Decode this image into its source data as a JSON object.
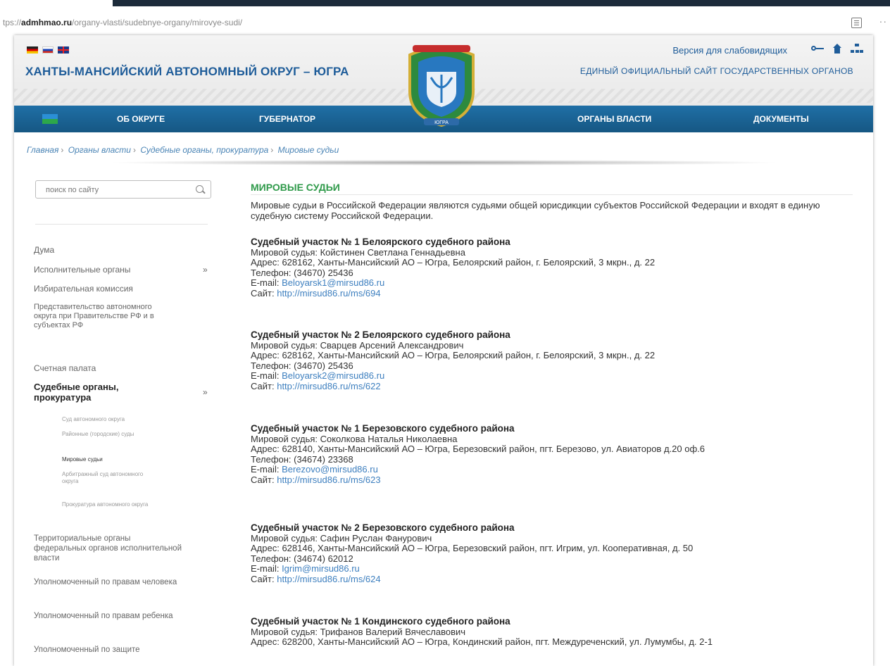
{
  "browser": {
    "url_prefix": "tps://",
    "url_host": "admhmao.ru",
    "url_path": "/organy-vlasti/sudebnye-organy/mirovye-sudi/",
    "more": "··"
  },
  "header": {
    "site_title": "ХАНТЫ-МАНСИЙСКИЙ АВТОНОМНЫЙ ОКРУГ – ЮГРА",
    "accessibility": "Версия для слабовидящих",
    "subtitle": "ЕДИНЫЙ ОФИЦИАЛЬНЫЙ САЙТ ГОСУДАРСТВЕННЫХ ОРГАНОВ",
    "emblem_ribbon": "ЮГРА"
  },
  "nav": {
    "items": [
      "ОБ ОКРУГЕ",
      "ГУБЕРНАТОР",
      "ОРГАНЫ ВЛАСТИ",
      "ДОКУМЕНТЫ"
    ]
  },
  "breadcrumb": [
    "Главная",
    "Органы власти",
    "Судебные органы, прокуратура",
    "Мировые судьи"
  ],
  "sidebar": {
    "search_placeholder": "поиск по сайту",
    "items": [
      "Дума",
      "Исполнительные органы",
      "Избирательная комиссия",
      "Представительство автономного округа при Правительстве РФ и в субъектах РФ",
      "Счетная палата",
      "Судебные органы, прокуратура",
      "Территориальные органы федеральных органов исполнительной власти",
      "Уполномоченный по правам человека",
      "Уполномоченный по правам ребенка",
      "Уполномоченный по защите"
    ],
    "subitems": [
      "Суд автономного округа",
      "Районные (городские) суды",
      "Мировые судьи",
      "Арбитражный суд автономного округа",
      "Прокуратура автономного округа"
    ]
  },
  "content": {
    "title": "МИРОВЫЕ СУДЬИ",
    "intro": "Мировые судьи в Российской Федерации являются судьями общей юрисдикции субъектов Российской Федерации и входят в единую судебную систему Российской Федерации.",
    "courts": [
      {
        "title": "Судебный участок № 1 Белоярского судебного района",
        "judge": "Мировой судья: Койстинен Светлана Геннадьевна",
        "address": "Адрес: 628162, Ханты-Мансийский АО – Югра, Белоярский район, г. Белоярский, 3 мкрн., д. 22",
        "phone": "Телефон: (34670) 25436",
        "email_label": "E-mail: ",
        "email": "Beloyarsk1@mirsud86.ru",
        "site_label": "Сайт: ",
        "site": "http://mirsud86.ru/ms/694"
      },
      {
        "title": "Судебный участок № 2 Белоярского судебного района",
        "judge": "Мировой судья: Сварцев Арсений Александрович",
        "address": "Адрес: 628162, Ханты-Мансийский АО – Югра, Белоярский район, г. Белоярский, 3 мкрн., д. 22",
        "phone": "Телефон: (34670) 25436",
        "email_label": "E-mail: ",
        "email": "Beloyarsk2@mirsud86.ru",
        "site_label": "Сайт: ",
        "site": "http://mirsud86.ru/ms/622"
      },
      {
        "title": "Судебный участок № 1 Березовского судебного района",
        "judge": "Мировой судья: Соколкова Наталья Николаевна",
        "address": "Адрес: 628140, Ханты-Мансийский АО – Югра, Березовский район, пгт. Березово, ул. Авиаторов д.20 оф.6",
        "phone": "Телефон: (34674) 23368",
        "email_label": "E-mail: ",
        "email": "Berezovo@mirsud86.ru",
        "site_label": "Сайт: ",
        "site": "http://mirsud86.ru/ms/623"
      },
      {
        "title": "Судебный участок № 2 Березовского судебного района",
        "judge": "Мировой судья: Сафин Руслан Фанурович",
        "address": "Адрес: 628146, Ханты-Мансийский АО – Югра, Березовский район, пгт. Игрим, ул. Кооперативная, д. 50",
        "phone": "Телефон: (34674) 62012",
        "email_label": "E-mail: ",
        "email": "Igrim@mirsud86.ru",
        "site_label": "Сайт: ",
        "site": "http://mirsud86.ru/ms/624"
      },
      {
        "title": "Судебный участок № 1 Кондинского судебного района",
        "judge": "Мировой судья: Трифанов Валерий Вячеславович",
        "address": "Адрес: 628200, Ханты-Мансийский АО – Югра, Кондинский район, пгт. Междуреченский, ул. Лумумбы, д. 2-1"
      }
    ]
  },
  "colors": {
    "brand_blue": "#1e5c99",
    "nav_blue": "#1f6fa6",
    "title_green": "#2f9a4a",
    "link_blue": "#3d7fbf"
  },
  "icons": [
    "reader-icon",
    "flag-de-icon",
    "flag-ru-icon",
    "flag-gb-icon",
    "key-icon",
    "home-icon",
    "sitemap-icon",
    "search-icon",
    "chevron-right-icon",
    "chevron-down-icon",
    "emblem-icon"
  ]
}
